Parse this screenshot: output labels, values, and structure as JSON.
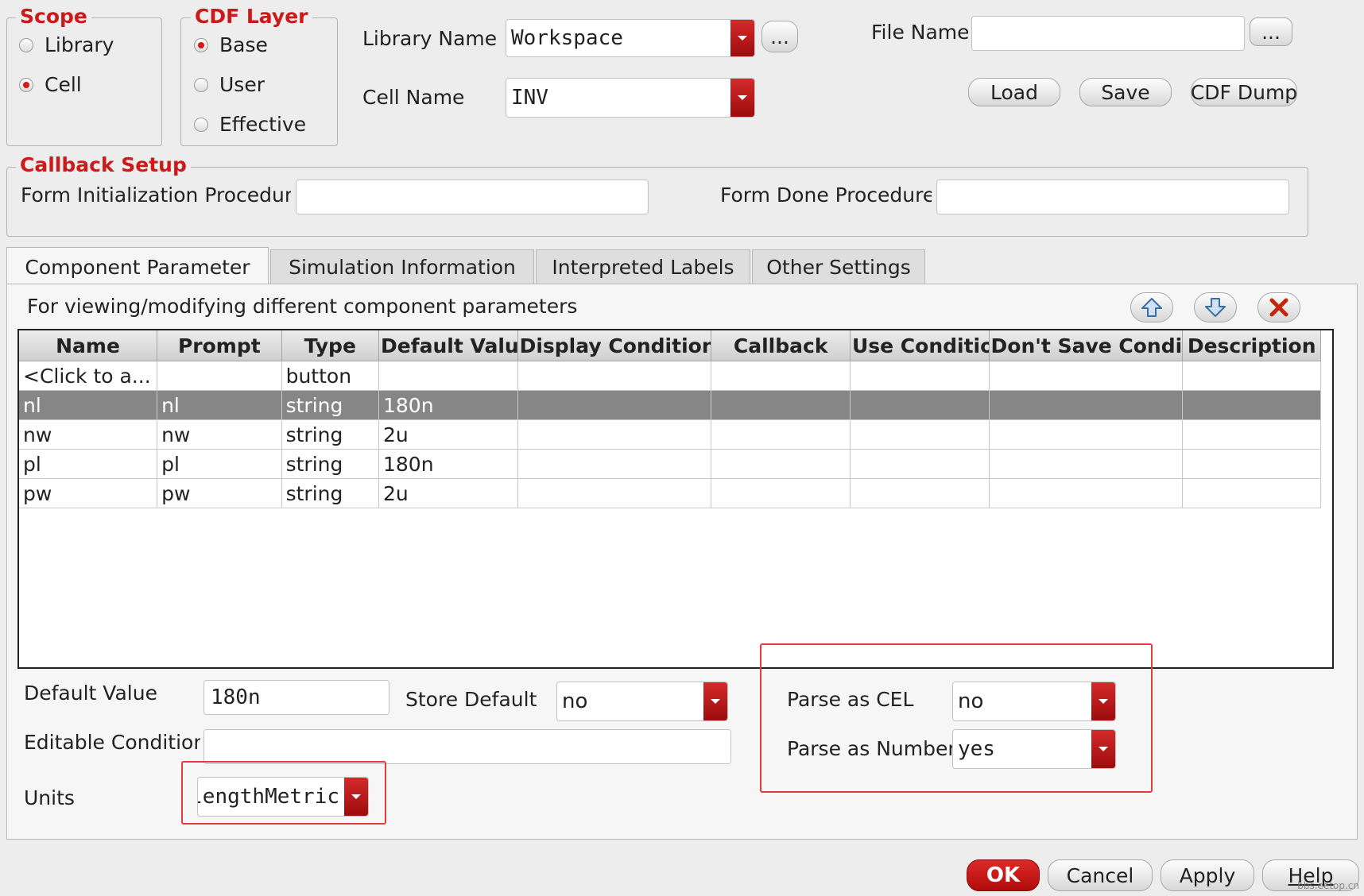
{
  "scope": {
    "title": "Scope",
    "options": [
      {
        "label": "Library",
        "selected": false
      },
      {
        "label": "Cell",
        "selected": true
      }
    ]
  },
  "cdf_layer": {
    "title": "CDF Layer",
    "options": [
      {
        "label": "Base",
        "selected": true
      },
      {
        "label": "User",
        "selected": false
      },
      {
        "label": "Effective",
        "selected": false
      }
    ]
  },
  "library": {
    "label": "Library Name",
    "value": "Workspace",
    "browse": "..."
  },
  "cell": {
    "label": "Cell Name",
    "value": "INV"
  },
  "file": {
    "label": "File Name",
    "value": "",
    "browse": "..."
  },
  "file_buttons": {
    "load": "Load",
    "save": "Save",
    "dump": "CDF Dump"
  },
  "callback": {
    "title": "Callback Setup",
    "init_label": "Form Initialization Procedure",
    "init_value": "",
    "done_label": "Form Done Procedure",
    "done_value": ""
  },
  "tabs": [
    "Component Parameter",
    "Simulation Information",
    "Interpreted Labels",
    "Other Settings"
  ],
  "panel": {
    "description": "For viewing/modifying different component parameters"
  },
  "table": {
    "columns": [
      "Name",
      "Prompt",
      "Type",
      "Default Value",
      "Display Condition",
      "Callback",
      "Use Condition",
      "Don't Save Condition",
      "Description"
    ],
    "rows": [
      [
        "<Click to a...",
        "",
        "button",
        "",
        "",
        "",
        "",
        "",
        ""
      ],
      [
        "nl",
        "nl",
        "string",
        "180n",
        "",
        "",
        "",
        "",
        ""
      ],
      [
        "nw",
        "nw",
        "string",
        "2u",
        "",
        "",
        "",
        "",
        ""
      ],
      [
        "pl",
        "pl",
        "string",
        "180n",
        "",
        "",
        "",
        "",
        ""
      ],
      [
        "pw",
        "pw",
        "string",
        "2u",
        "",
        "",
        "",
        "",
        ""
      ]
    ],
    "selected_row": 1
  },
  "details": {
    "default_value_label": "Default Value",
    "default_value": "180n",
    "store_default_label": "Store Default",
    "store_default": "no",
    "editable_label": "Editable Condition",
    "editable_value": "",
    "units_label": "Units",
    "units_value": "lengthMetric",
    "parse_cel_label": "Parse as CEL",
    "parse_cel": "no",
    "parse_number_label": "Parse as Number",
    "parse_number": "yes"
  },
  "footer": {
    "ok": "OK",
    "cancel": "Cancel",
    "apply": "Apply",
    "help": "Help"
  },
  "watermark": "bbs.eetop.cn",
  "colors": {
    "accent": "#cc1a1a",
    "selected_row": "#868686",
    "highlight": "#e8393f"
  }
}
